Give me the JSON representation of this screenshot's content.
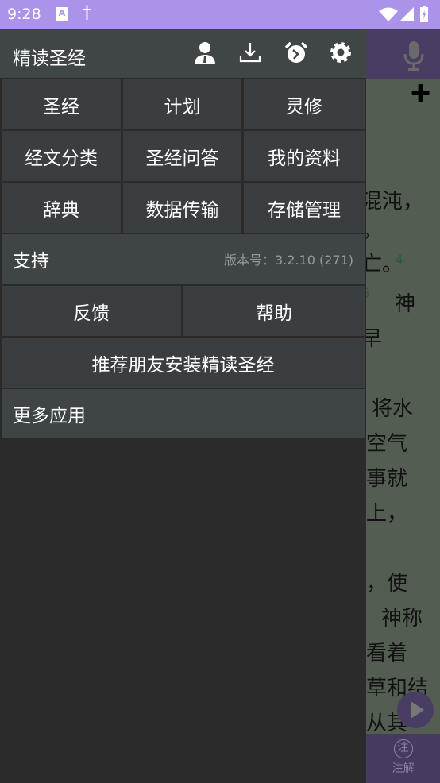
{
  "status_bar": {
    "time": "9:28",
    "notif_a": "A",
    "notif_cross": "†"
  },
  "drawer": {
    "title": "精读圣经",
    "header_icons": [
      "user-icon",
      "download-icon",
      "alarm-icon",
      "settings-icon"
    ],
    "grid": [
      "圣经",
      "计划",
      "灵修",
      "经文分类",
      "圣经问答",
      "我的资料",
      "辞典",
      "数据传输",
      "存储管理"
    ],
    "support_label": "支持",
    "version": "版本号：3.2.10 (271)",
    "feedback": "反馈",
    "help": "帮助",
    "recommend": "推荐朋友安装精读圣经",
    "more_apps": "更多应用"
  },
  "background": {
    "lines": [
      "混沌，",
      "。",
      "亡。",
      "神",
      "早",
      "将水",
      "空气",
      "事就",
      "上，",
      "，使",
      "神称",
      "看着",
      "草和结",
      "从其"
    ],
    "verse_numbers": [
      "4",
      "5"
    ],
    "notes_icon": "注",
    "notes_label": "注解"
  },
  "colors": {
    "status_bar": "#ab93ea",
    "drawer_header": "#404545",
    "accent_dark": "#4a3d63"
  }
}
